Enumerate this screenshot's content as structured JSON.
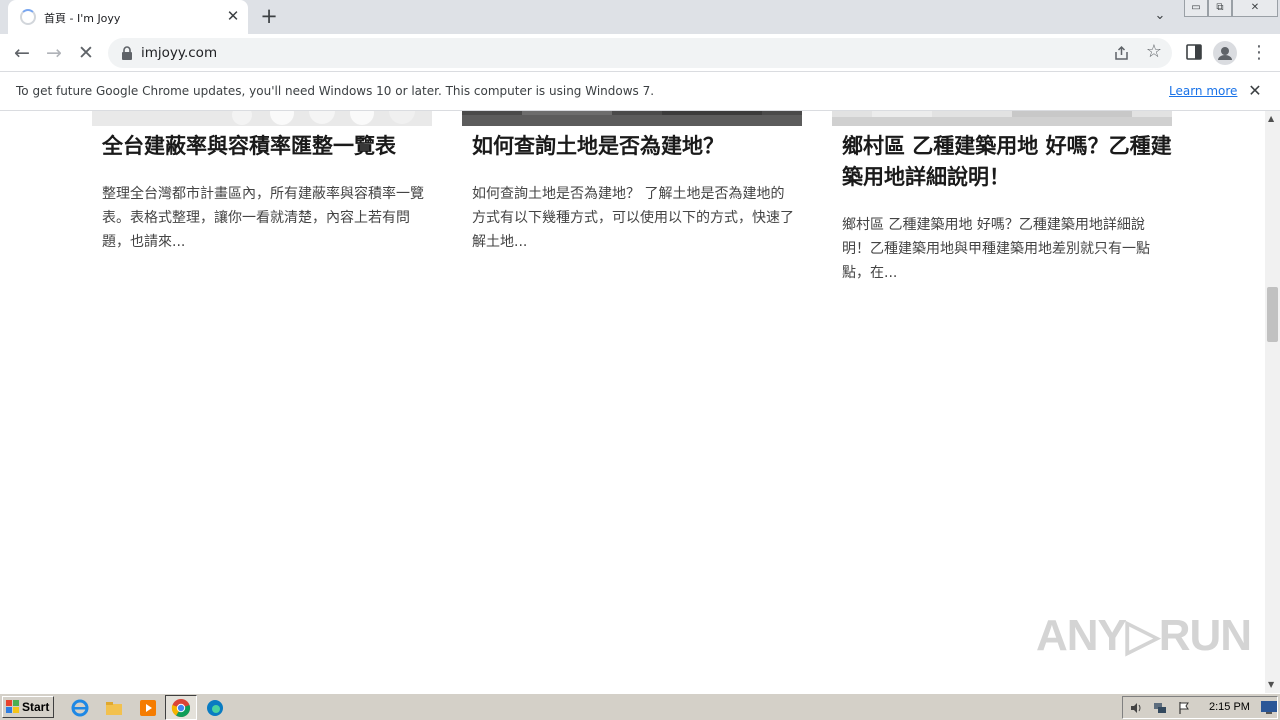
{
  "browser": {
    "tab": {
      "title": "首頁 - I'm Joyy",
      "close": "✕"
    },
    "new_tab": "+",
    "tab_list": "⌄",
    "window_buttons": {
      "minimize": "▭",
      "restore": "⧉",
      "close": "✕"
    },
    "nav": {
      "back": "←",
      "forward": "→",
      "stop": "✕"
    },
    "url": "imjoyy.com",
    "star": "☆",
    "menu": "⋮"
  },
  "infobar": {
    "message": "To get future Google Chrome updates, you'll need Windows 10 or later. This computer is using Windows 7.",
    "learn_more": "Learn more",
    "close": "✕"
  },
  "articles": [
    {
      "title": "全台建蔽率與容積率匯整一覽表",
      "excerpt": "整理全台灣都市計畫區內，所有建蔽率與容積率一覽表。表格式整理，讓你一看就清楚，內容上若有問題，也請來..."
    },
    {
      "title": "如何查詢土地是否為建地？",
      "excerpt": "如何查詢土地是否為建地？ 了解土地是否為建地的方式有以下幾種方式，可以使用以下的方式，快速了解土地..."
    },
    {
      "title": "鄉村區 乙種建築用地 好嗎？乙種建築用地詳細說明！",
      "excerpt": "鄉村區 乙種建築用地 好嗎？乙種建築用地詳細說明！乙種建築用地與甲種建築用地差別就只有一點點，在..."
    }
  ],
  "scrollbar": {
    "up": "▲",
    "down": "▼"
  },
  "watermark": "ANY▷RUN",
  "taskbar": {
    "start": "Start",
    "clock": "2:15 PM"
  },
  "colors": {
    "link": "#1a73e8",
    "tabstrip": "#dee1e6",
    "taskbar": "#d4d0c8"
  }
}
